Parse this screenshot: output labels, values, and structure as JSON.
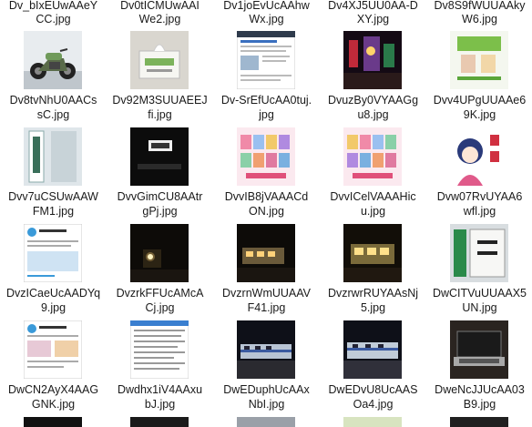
{
  "top_labels": [
    [
      "Dv_bIxEUwAAeY",
      "CC.jpg"
    ],
    [
      "Dv0tICMUwAAI",
      "We2.jpg"
    ],
    [
      "Dv1joEvUcAAhw",
      "Wx.jpg"
    ],
    [
      "Dv4XJ5UU0AA-D",
      "XY.jpg"
    ],
    [
      "Dv8S9fWUUAAky",
      "W6.jpg"
    ]
  ],
  "rows": [
    [
      {
        "l1": "Dv8tvNhU0AACs",
        "l2": "sC.jpg",
        "icon": "motorcycle-thumbnail"
      },
      {
        "l1": "Dv92M3SUUAEEJ",
        "l2": "fi.jpg",
        "icon": "tissue-box-thumbnail"
      },
      {
        "l1": "Dv-SrEfUcAA0tuj.",
        "l2": "jpg",
        "icon": "web-page-thumbnail"
      },
      {
        "l1": "DvuzBy0VYAAGg",
        "l2": "u8.jpg",
        "icon": "night-lights-thumbnail"
      },
      {
        "l1": "Dvv4UPgUUAAe6",
        "l2": "9K.jpg",
        "icon": "green-poster-thumbnail"
      }
    ],
    [
      {
        "l1": "Dvv7uCSUwAAW",
        "l2": "FM1.jpg",
        "icon": "station-sign-thumbnail"
      },
      {
        "l1": "DvvGimCU8AAtr",
        "l2": "gPj.jpg",
        "icon": "train-sign-thumbnail"
      },
      {
        "l1": "DvvIB8jVAAACd",
        "l2": "ON.jpg",
        "icon": "card-grid-thumbnail"
      },
      {
        "l1": "DvvICelVAAAHic",
        "l2": "u.jpg",
        "icon": "card-grid-thumbnail"
      },
      {
        "l1": "Dvw07RvUYAA6",
        "l2": "wfl.jpg",
        "icon": "anime-girl-thumbnail"
      }
    ],
    [
      {
        "l1": "DvzICaeUcAADYq",
        "l2": "9.jpg",
        "icon": "tweet-thumbnail"
      },
      {
        "l1": "DvzrkFFUcAMcA",
        "l2": "Cj.jpg",
        "icon": "night-train-thumbnail"
      },
      {
        "l1": "DvzrnWmUUAAV",
        "l2": "F41.jpg",
        "icon": "night-train-thumbnail"
      },
      {
        "l1": "DvzrwrRUYAAsNj",
        "l2": "5.jpg",
        "icon": "night-train-thumbnail"
      },
      {
        "l1": "DwCITVuUUAAX5",
        "l2": "UN.jpg",
        "icon": "station-sign-thumbnail"
      }
    ],
    [
      {
        "l1": "DwCN2AyX4AAG",
        "l2": "GNK.jpg",
        "icon": "tweet-thumbnail"
      },
      {
        "l1": "Dwdhx1iV4AAxu",
        "l2": "bJ.jpg",
        "icon": "list-page-thumbnail"
      },
      {
        "l1": "DwEDuphUcAAx",
        "l2": "NbI.jpg",
        "icon": "train-platform-thumbnail"
      },
      {
        "l1": "DwEDvU8UcAAS",
        "l2": "Oa4.jpg",
        "icon": "train-platform-thumbnail"
      },
      {
        "l1": "DweNcJJUcAA03",
        "l2": "B9.jpg",
        "icon": "laptop-thumbnail"
      }
    ]
  ]
}
